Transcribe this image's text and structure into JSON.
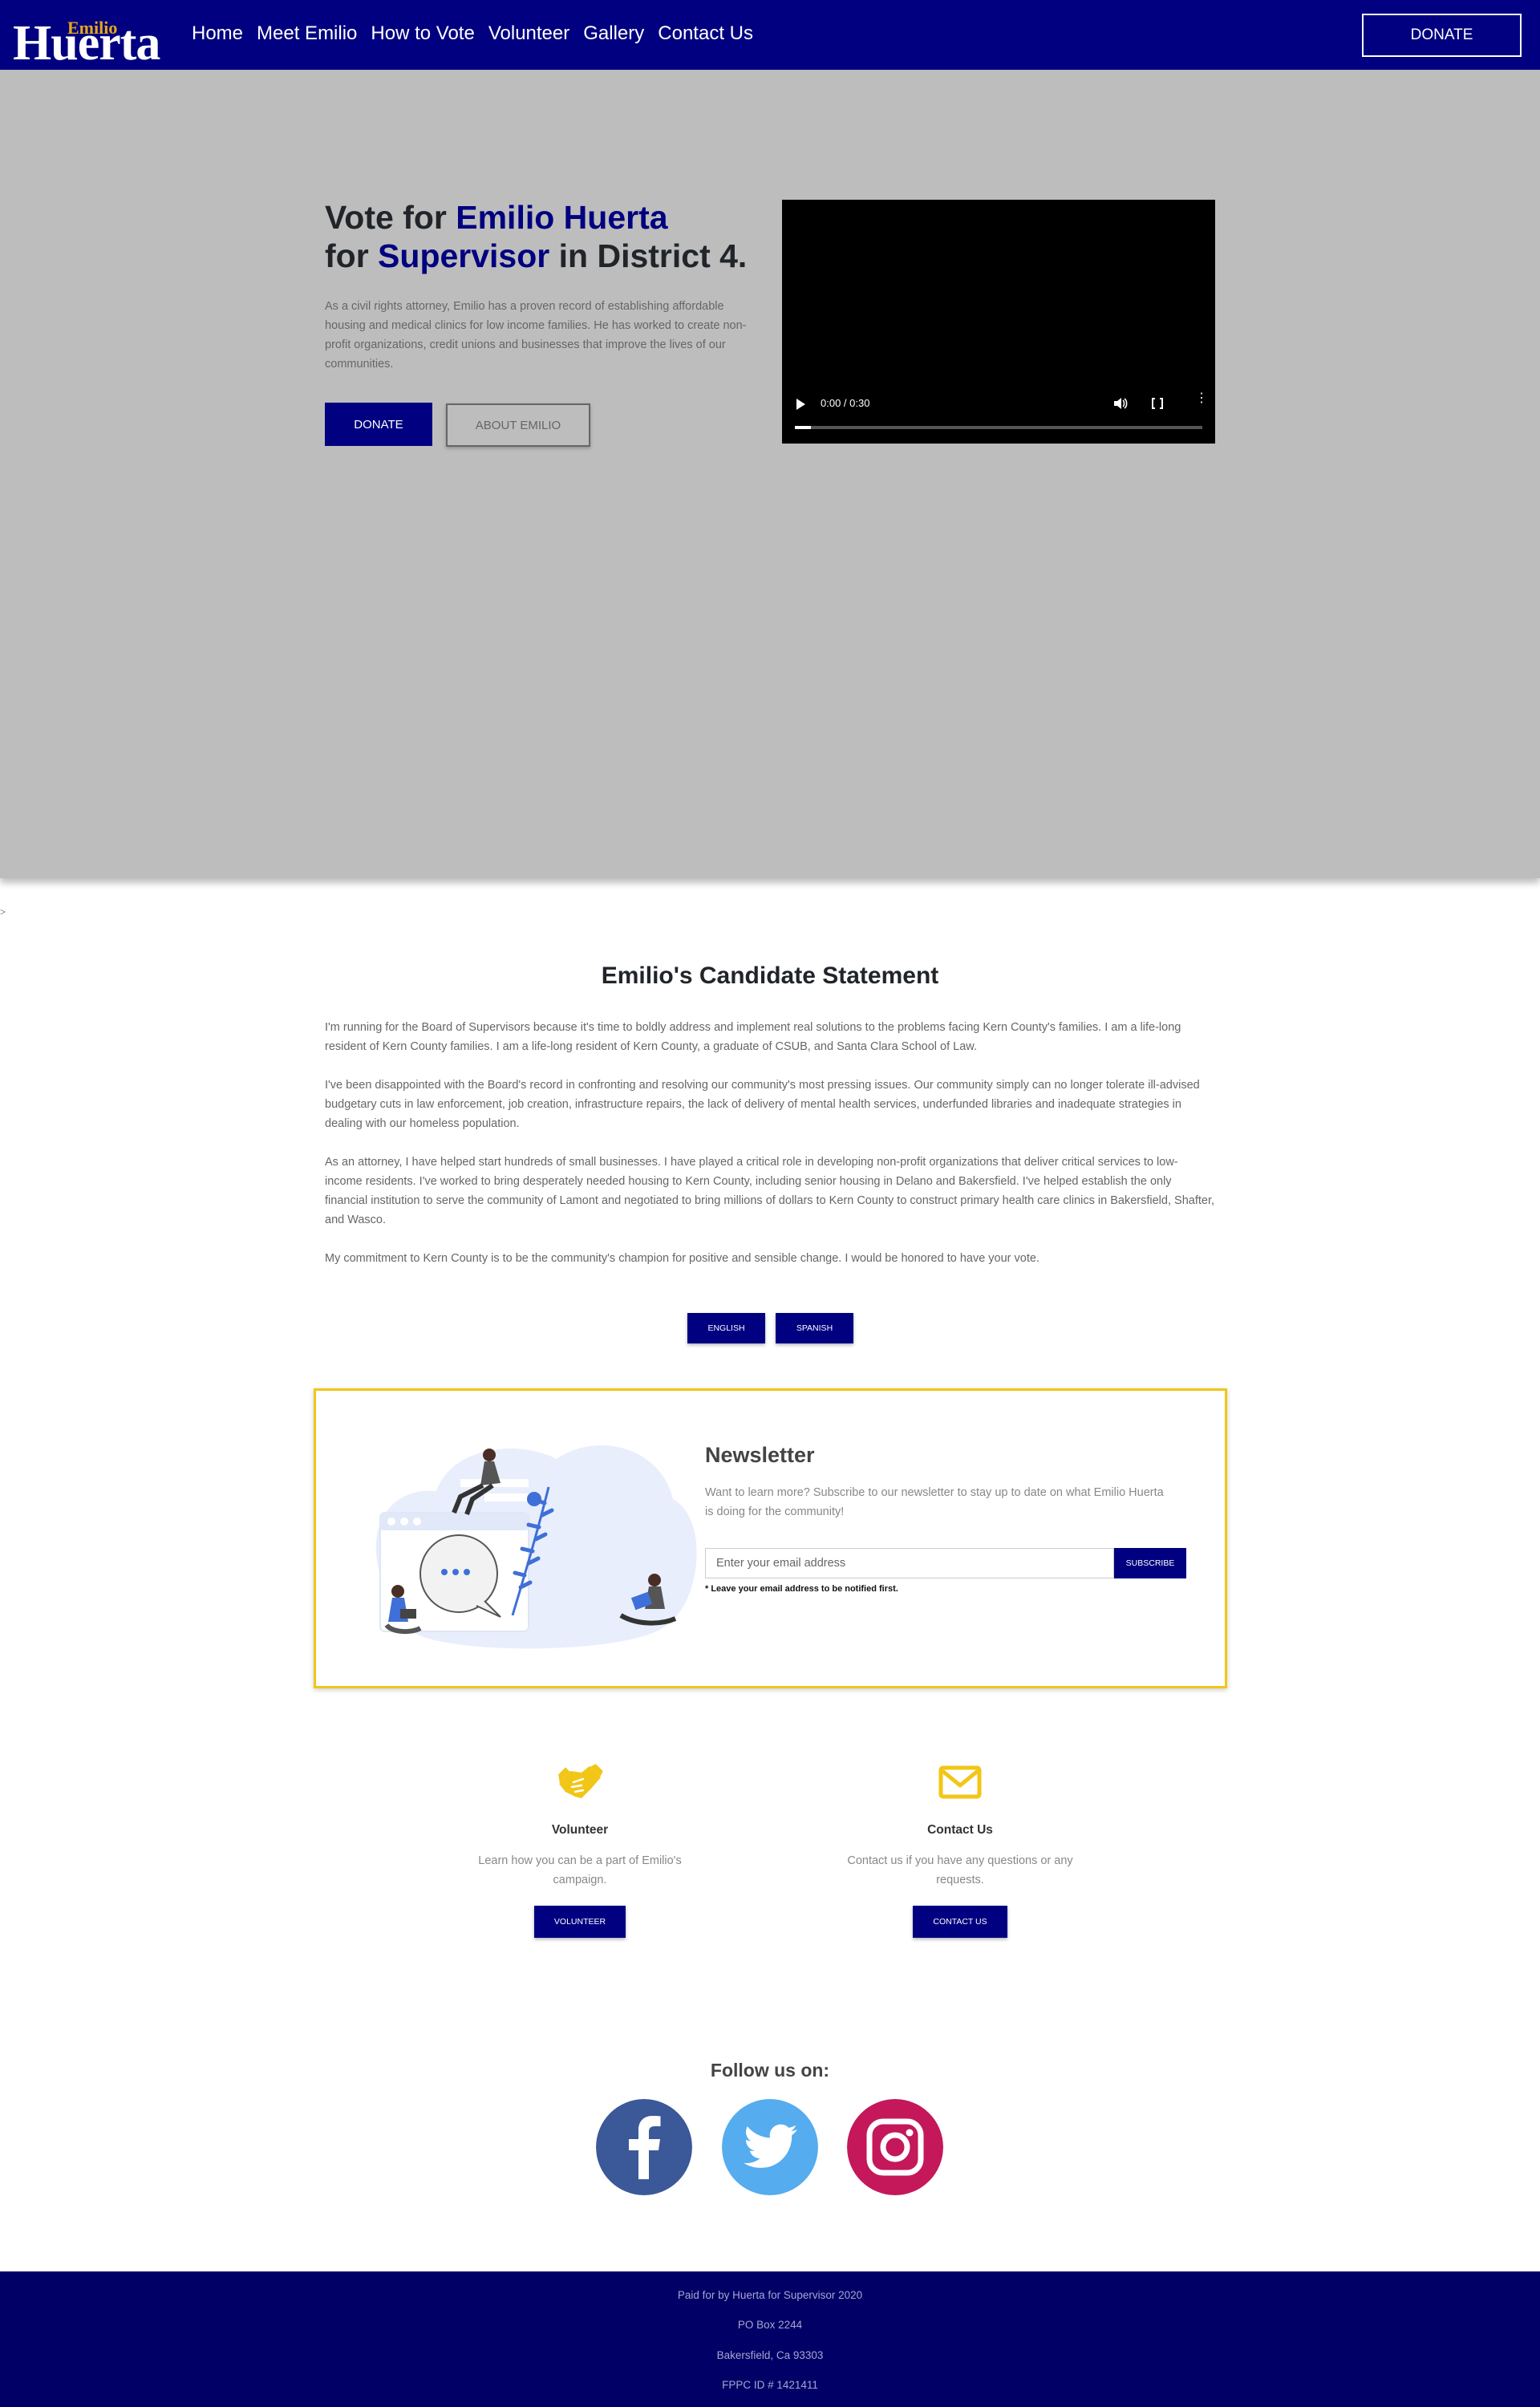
{
  "nav": {
    "logo_small": "Emilio",
    "logo_big": "Huerta",
    "links": [
      "Home",
      "Meet Emilio",
      "How to Vote",
      "Volunteer",
      "Gallery",
      "Contact Us"
    ],
    "donate": "DONATE"
  },
  "hero": {
    "title_1": "Vote for ",
    "title_name": "Emilio Huerta",
    "title_2": "for ",
    "title_office": "Supervisor",
    "title_3": " in District 4.",
    "text": "As a civil rights attorney, Emilio has a proven record of establishing affordable housing and medical clinics for low income families. He has worked to create non-profit organizations, credit unions and businesses that improve the lives of our communities.",
    "donate": "DONATE",
    "about": "ABOUT EMILIO",
    "video_time": "0:00 / 0:30",
    "video_progress": 0.04
  },
  "stray_text": ">",
  "statement": {
    "title": "Emilio's Candidate Statement",
    "paragraphs": [
      "I'm running for the Board of Supervisors because it's time to boldly address and implement real solutions to the problems facing Kern County's families. I am a life-long resident of Kern County families. I am a life-long resident of Kern County, a graduate of CSUB, and Santa Clara School of Law.",
      "I've been disappointed with the Board's record in confronting and resolving our community's most pressing issues. Our community simply can no longer tolerate ill-advised budgetary cuts in law enforcement, job creation, infrastructure repairs, the lack of delivery of mental health services, underfunded libraries and inadequate strategies in dealing with our homeless population.",
      "As an attorney, I have helped start hundreds of small businesses. I have played a critical role in developing non-profit organizations that deliver critical services to low-income residents. I've worked to bring desperately needed housing to Kern County, including senior housing in Delano and Bakersfield. I've helped establish the only financial institution to serve the community of Lamont and negotiated to bring millions of dollars to Kern County to construct primary health care clinics in Bakersfield, Shafter, and Wasco.",
      "My commitment to Kern County is to be the community's champion for positive and sensible change. I would be honored to have your vote."
    ],
    "english": "ENGLISH",
    "spanish": "SPANISH"
  },
  "newsletter": {
    "title": "Newsletter",
    "text": "Want to learn more? Subscribe to our newsletter to stay up to date on what Emilio Huerta is doing for the community!",
    "placeholder": "Enter your email address",
    "subscribe": "SUBSCRIBE",
    "note": "* Leave your email address to be notified first."
  },
  "features": {
    "volunteer": {
      "title": "Volunteer",
      "text": "Learn how you can be a part of Emilio's campaign.",
      "button": "VOLUNTEER"
    },
    "contact": {
      "title": "Contact Us",
      "text": "Contact us if you have any questions or any requests.",
      "button": "CONTACT US"
    }
  },
  "follow": {
    "title": "Follow us on:"
  },
  "colors": {
    "brand_navy": "#000080",
    "accent_gold": "#f2c617",
    "facebook": "#3b5998",
    "twitter": "#55acee",
    "instagram": "#c4185b"
  },
  "footer": {
    "lines": [
      "Paid for by Huerta for Supervisor 2020",
      "PO Box 2244",
      "Bakersfield, Ca 93303",
      "FPPC ID # 1421411"
    ]
  }
}
